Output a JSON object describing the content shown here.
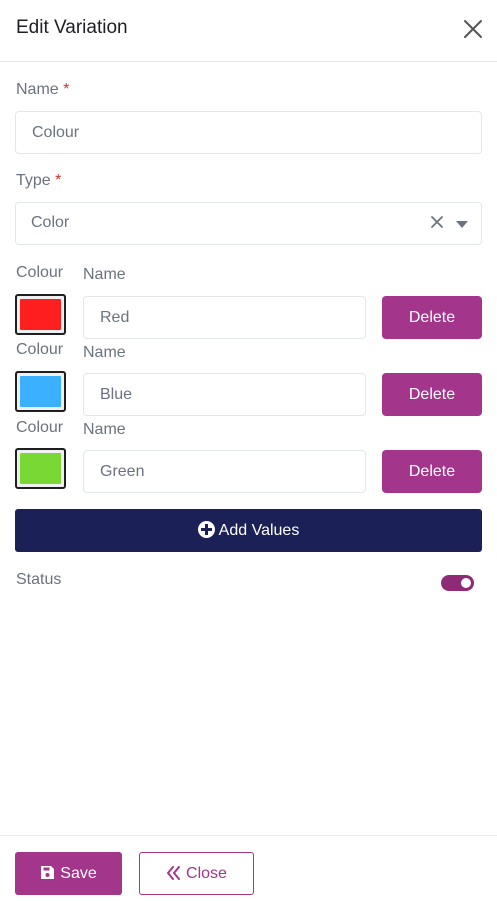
{
  "header": {
    "title": "Edit Variation"
  },
  "form": {
    "name_label": "Name",
    "name_required": "*",
    "name_value": "Colour",
    "type_label": "Type",
    "type_required": "*",
    "type_value": "Color",
    "colour_label": "Colour",
    "value_name_label": "Name",
    "values": [
      {
        "color": "#ff1f1f",
        "name": "Red",
        "delete_label": "Delete"
      },
      {
        "color": "#3ab0ff",
        "name": "Blue",
        "delete_label": "Delete"
      },
      {
        "color": "#7ad835",
        "name": "Green",
        "delete_label": "Delete"
      }
    ],
    "add_values_label": "Add Values",
    "status_label": "Status",
    "status_enabled": true
  },
  "footer": {
    "save_label": "Save",
    "close_label": "Close"
  },
  "colors": {
    "primary": "#a3358b",
    "navy": "#1b2157",
    "toggle": "#8e2a76"
  }
}
